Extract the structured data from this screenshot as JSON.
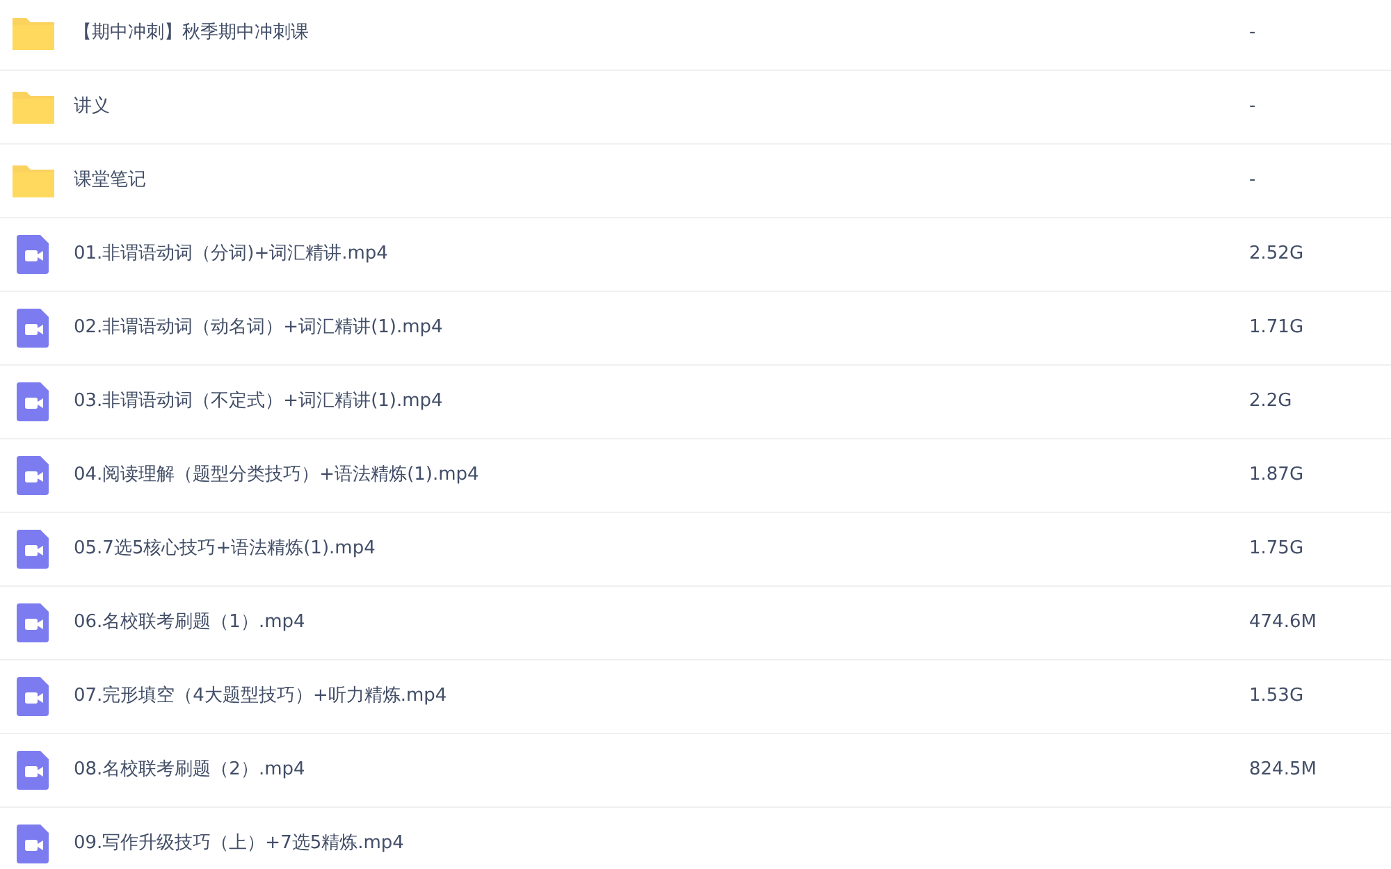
{
  "files": [
    {
      "kind": "folder",
      "name": "【期中冲刺】秋季期中冲刺课",
      "size": "-"
    },
    {
      "kind": "folder",
      "name": "讲义",
      "size": "-"
    },
    {
      "kind": "folder",
      "name": "课堂笔记",
      "size": "-"
    },
    {
      "kind": "video",
      "name": "01.非谓语动词（分词)+词汇精讲.mp4",
      "size": "2.52G"
    },
    {
      "kind": "video",
      "name": "02.非谓语动词（动名词）+词汇精讲(1).mp4",
      "size": "1.71G"
    },
    {
      "kind": "video",
      "name": "03.非谓语动词（不定式）+词汇精讲(1).mp4",
      "size": "2.2G"
    },
    {
      "kind": "video",
      "name": "04.阅读理解（题型分类技巧）+语法精炼(1).mp4",
      "size": "1.87G"
    },
    {
      "kind": "video",
      "name": "05.7选5核心技巧+语法精炼(1).mp4",
      "size": "1.75G"
    },
    {
      "kind": "video",
      "name": "06.名校联考刷题（1）.mp4",
      "size": "474.6M"
    },
    {
      "kind": "video",
      "name": "07.完形填空（4大题型技巧）+听力精炼.mp4",
      "size": "1.53G"
    },
    {
      "kind": "video",
      "name": "08.名校联考刷题（2）.mp4",
      "size": "824.5M"
    },
    {
      "kind": "video",
      "name": "09.写作升级技巧（上）+7选5精炼.mp4"
    }
  ]
}
